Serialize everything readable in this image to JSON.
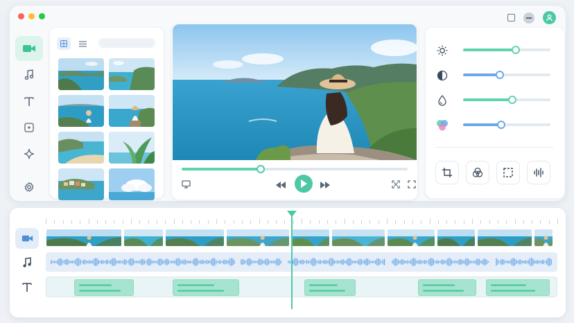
{
  "window": {
    "controls": [
      {
        "name": "close",
        "color": "#ff5f57"
      },
      {
        "name": "minimize",
        "color": "#febc2e"
      },
      {
        "name": "maximize",
        "color": "#28c840"
      }
    ],
    "right_icons": [
      "window-icon",
      "minimize-icon",
      "user-avatar-icon"
    ]
  },
  "sidebar": {
    "items": [
      {
        "icon": "video-camera-icon",
        "active": true
      },
      {
        "icon": "music-note-icon",
        "active": false
      },
      {
        "icon": "text-icon",
        "active": false
      },
      {
        "icon": "sticker-icon",
        "active": false
      },
      {
        "icon": "sparkle-effects-icon",
        "active": false
      },
      {
        "icon": "settings-gear-icon",
        "active": false
      }
    ]
  },
  "media_panel": {
    "view_modes": [
      "grid-view-icon",
      "list-view-icon"
    ],
    "search_placeholder": "",
    "thumbnails": [
      "coast",
      "cliff-bay",
      "woman-sea",
      "woman-hat",
      "beach-cove",
      "palm-leaves",
      "village",
      "clouds"
    ]
  },
  "preview": {
    "progress": 0.35,
    "controls": [
      "monitor-icon",
      "rewind-icon",
      "play-icon",
      "fast-forward-icon",
      "expand-icon",
      "fullscreen-icon"
    ]
  },
  "adjustments": {
    "sliders": [
      {
        "name": "brightness",
        "icon": "sun-icon",
        "value": 0.6,
        "color": "#5fd3ad"
      },
      {
        "name": "contrast",
        "icon": "contrast-icon",
        "value": 0.42,
        "color": "#6aa8e8"
      },
      {
        "name": "saturation",
        "icon": "droplet-icon",
        "value": 0.56,
        "color": "#5fd3ad"
      },
      {
        "name": "color",
        "icon": "color-circles-icon",
        "value": 0.44,
        "color": "#6aa8e8"
      }
    ],
    "tools": [
      "crop-icon",
      "filters-icon",
      "select-frame-icon",
      "audio-waves-icon"
    ]
  },
  "timeline": {
    "tracks": [
      {
        "type": "video",
        "icon": "video-camera-icon"
      },
      {
        "type": "audio",
        "icon": "music-note-icon"
      },
      {
        "type": "text",
        "icon": "text-icon"
      }
    ],
    "playhead": 0.48,
    "video_clips": 10,
    "audio_segments": 5,
    "text_clips": 5
  }
}
